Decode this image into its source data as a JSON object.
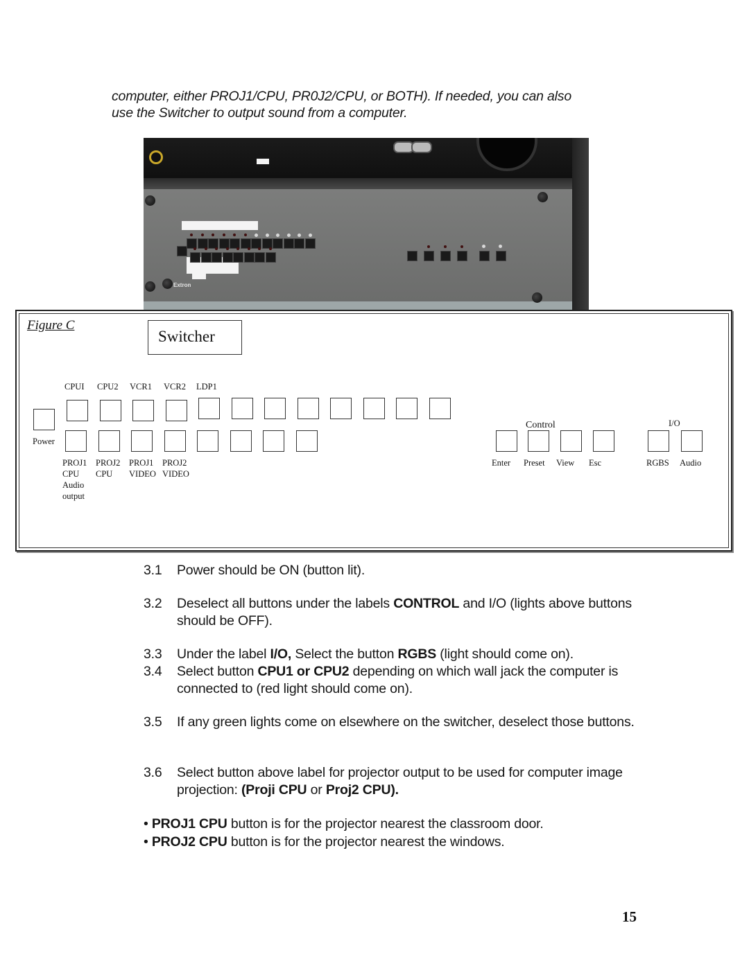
{
  "intro_text": {
    "line1": "computer, either PROJ1/CPU, PR0J2/CPU, or BOTH).  If needed, you can also",
    "line2": "use the Switcher to output sound from a computer."
  },
  "photo": {
    "description": "Photo of Extron switcher front panel in equipment rack",
    "brand": "Extron"
  },
  "figure": {
    "caption": "Figure C",
    "title": "Switcher",
    "power_label": "Power",
    "top_row_labels": [
      "CPUI",
      "CPU2",
      "VCR1",
      "VCR2",
      "LDP1"
    ],
    "top_row_button_count": 12,
    "bottom_row_button_count": 8,
    "bottom_row_labels": [
      {
        "lines": [
          "PROJ1",
          "CPU",
          "Audio",
          "output"
        ]
      },
      {
        "lines": [
          "PROJ2",
          "CPU"
        ]
      },
      {
        "lines": [
          "PROJ1",
          "VIDEO"
        ]
      },
      {
        "lines": [
          "PROJ2",
          "VIDEO"
        ]
      }
    ],
    "control": {
      "heading": "Control",
      "buttons": [
        "Enter",
        "Preset",
        "View",
        "Esc"
      ]
    },
    "io": {
      "heading": "I/O",
      "buttons": [
        "RGBS",
        "Audio"
      ]
    }
  },
  "steps": [
    {
      "num": "3.1",
      "parts": [
        {
          "t": "Power should be ON (button lit)."
        }
      ]
    },
    {
      "num": "3.2",
      "parts": [
        {
          "t": "Deselect all buttons under the labels "
        },
        {
          "t": "CONTROL",
          "b": true
        },
        {
          "t": " and I/O (lights above buttons should be OFF)."
        }
      ]
    },
    {
      "num": "3.3",
      "parts": [
        {
          "t": "Under the label "
        },
        {
          "t": "I/O,",
          "b": true
        },
        {
          "t": " Select the button "
        },
        {
          "t": "RGBS",
          "b": true
        },
        {
          "t": " (light should come on)."
        }
      ]
    },
    {
      "num": "3.4",
      "parts": [
        {
          "t": "Select button "
        },
        {
          "t": "CPU1  or CPU2",
          "b": true
        },
        {
          "t": " depending on which wall jack the computer is connected to (red light should come on)."
        }
      ]
    },
    {
      "num": "3.5",
      "parts": [
        {
          "t": "If any green lights come on elsewhere on the switcher, deselect those buttons."
        }
      ]
    },
    {
      "num": "3.6",
      "parts": [
        {
          "t": "Select button above label for projector output to be used for computer image projection:  "
        },
        {
          "t": "(Proji  CPU",
          "b": true
        },
        {
          "t": " or "
        },
        {
          "t": "Proj2 CPU).",
          "b": true
        }
      ]
    }
  ],
  "bullets": [
    {
      "bold": "PROJ1  CPU",
      "rest": " button is for the projector nearest the classroom door."
    },
    {
      "bold": "PROJ2 CPU",
      "rest": " button is for the projector nearest the windows."
    }
  ],
  "bullet_glyph": "•",
  "page_number": "15"
}
